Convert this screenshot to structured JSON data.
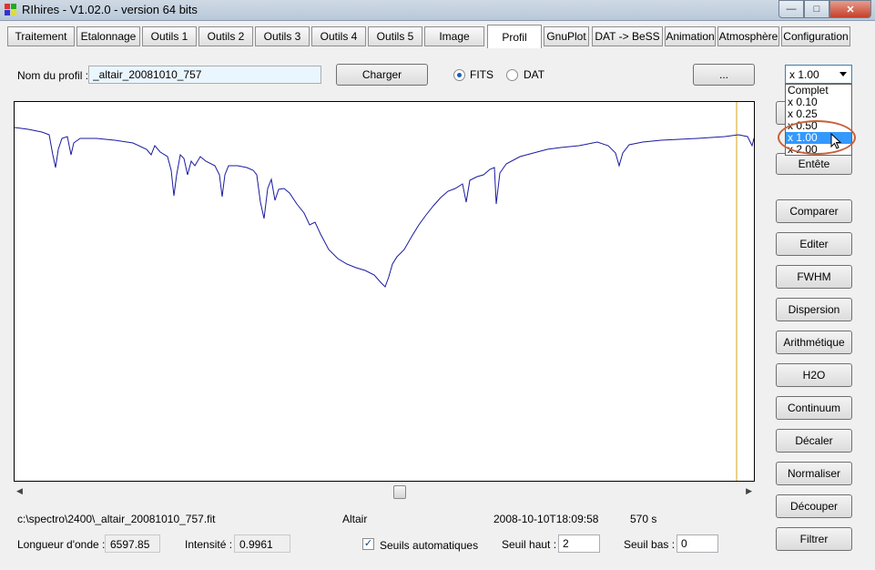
{
  "window": {
    "title": "RIhires - V1.02.0 - version 64 bits"
  },
  "tabs": [
    "Traitement",
    "Etalonnage",
    "Outils 1",
    "Outils 2",
    "Outils 3",
    "Outils 4",
    "Outils 5",
    "Image",
    "Profil",
    "GnuPlot",
    "DAT -> BeSS",
    "Animation",
    "Atmosphère",
    "Configuration"
  ],
  "active_tab": "Profil",
  "profile": {
    "name_label": "Nom du profil :",
    "name_value": "_altair_20081010_757",
    "load_button": "Charger",
    "format_options": [
      "FITS",
      "DAT"
    ],
    "format_selected": "FITS",
    "browse_button": "..."
  },
  "zoom": {
    "selected": "x 1.00",
    "options": [
      "Complet",
      "x 0.10",
      "x 0.25",
      "x 0.50",
      "x 1.00",
      "x 2.00"
    ],
    "highlighted": "x 1.00"
  },
  "side_buttons": [
    "Entête",
    "Comparer",
    "Editer",
    "FWHM",
    "Dispersion",
    "Arithmétique",
    "H2O",
    "Continuum",
    "Décaler",
    "Normaliser",
    "Découper",
    "Filtrer"
  ],
  "status": {
    "path": "c:\\spectro\\2400\\_altair_20081010_757.fit",
    "object": "Altair",
    "date": "2008-10-10T18:09:58",
    "exposure": "570 s",
    "wavelength_label": "Longueur d'onde :",
    "wavelength_value": "6597.85",
    "intensity_label": "Intensité :",
    "intensity_value": "0.9961",
    "auto_thresholds_label": "Seuils automatiques",
    "auto_thresholds_checked": true,
    "upper_threshold_label": "Seuil haut :",
    "upper_threshold_value": "2",
    "lower_threshold_label": "Seuil bas :",
    "lower_threshold_value": "0"
  },
  "colors": {
    "spectrum": "#1a1aa0",
    "cursor_line": "#d4a017",
    "selection": "#3399ff",
    "annotation": "#c8603a"
  }
}
